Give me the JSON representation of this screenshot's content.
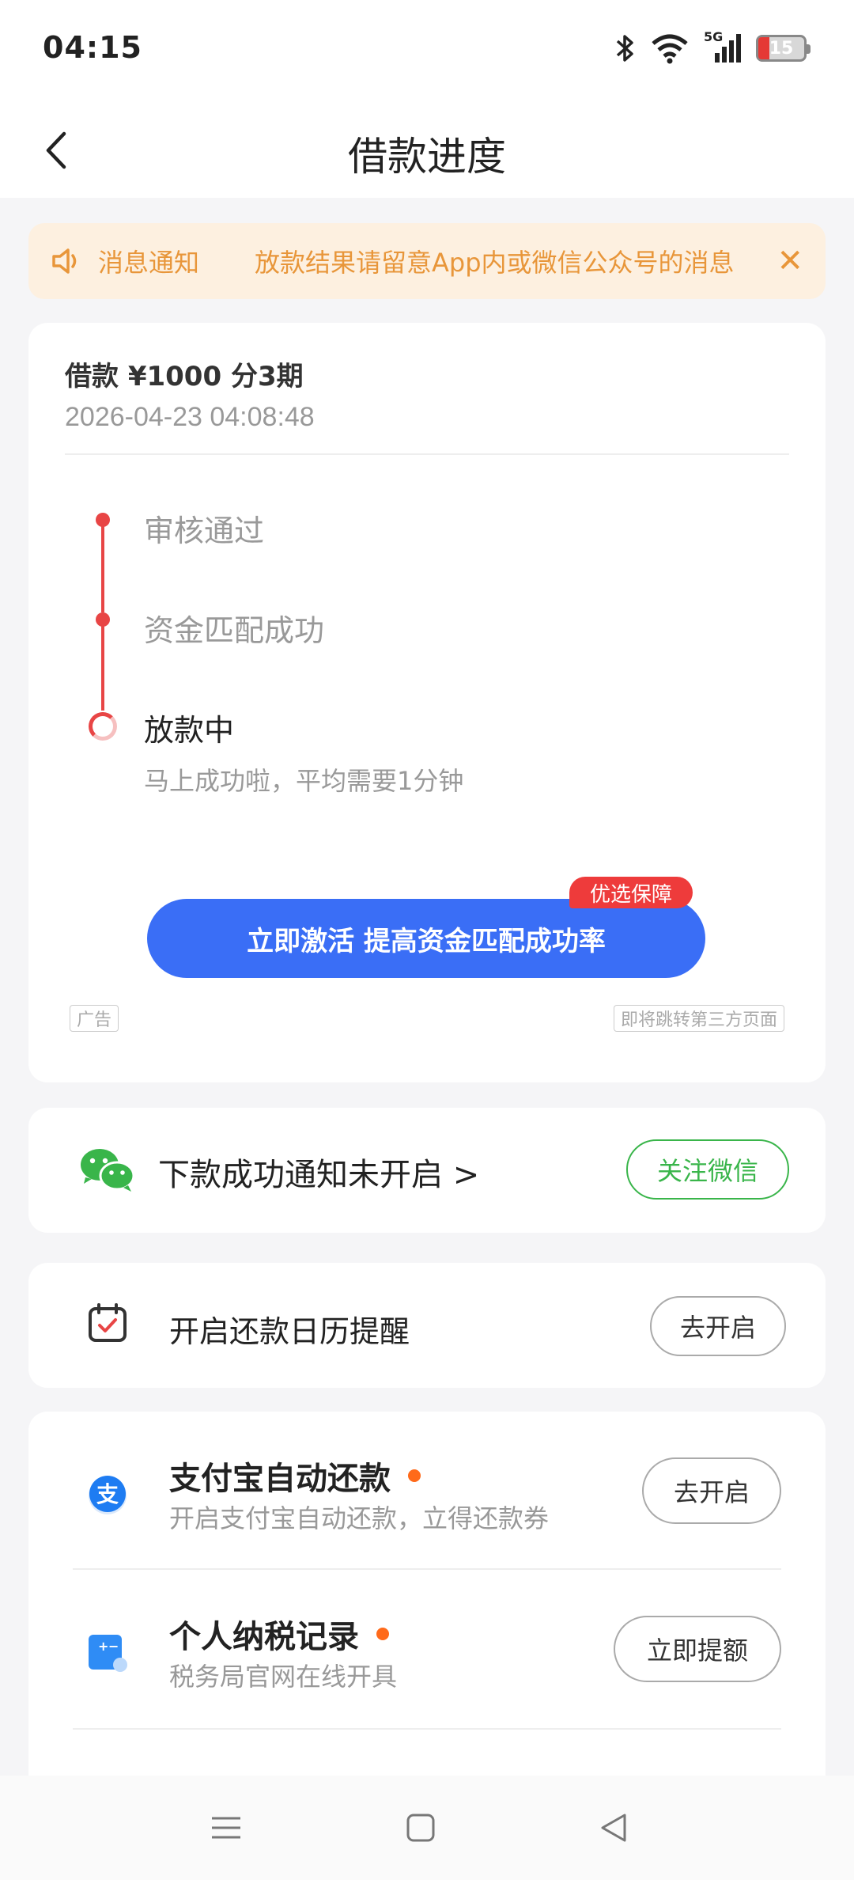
{
  "status_bar": {
    "time": "04:15",
    "network": "5G",
    "battery": "15"
  },
  "header": {
    "title": "借款进度"
  },
  "notice": {
    "label": "消息通知",
    "text": "放款结果请留意App内或微信公众号的消息"
  },
  "loan": {
    "title": "借款 ¥1000  分3期",
    "datetime": "2026-04-23 04:08:48",
    "steps": [
      {
        "label": "审核通过",
        "status": "done"
      },
      {
        "label": "资金匹配成功",
        "status": "done"
      },
      {
        "label": "放款中",
        "status": "in-progress",
        "sub": "马上成功啦，平均需要1分钟"
      }
    ],
    "cta_label": "立即激活 提高资金匹配成功率",
    "cta_badge": "优选保障",
    "ad_tag": "广告",
    "redirect_tag": "即将跳转第三方页面"
  },
  "wechat": {
    "text": "下款成功通知未开启 >",
    "button": "关注微信"
  },
  "calendar": {
    "text": "开启还款日历提醒",
    "button": "去开启"
  },
  "list": [
    {
      "title": "支付宝自动还款",
      "sub": "开启支付宝自动还款，立得还款券",
      "button": "去开启"
    },
    {
      "title": "个人纳税记录",
      "sub": "税务局官网在线开具",
      "button": "立即提额"
    }
  ],
  "colors": {
    "primary_blue": "#3a6ef6",
    "progress_red": "#e84545",
    "wechat_green": "#39b54a",
    "notice_orange": "#e8963a",
    "dot_orange": "#ff6a1a"
  }
}
